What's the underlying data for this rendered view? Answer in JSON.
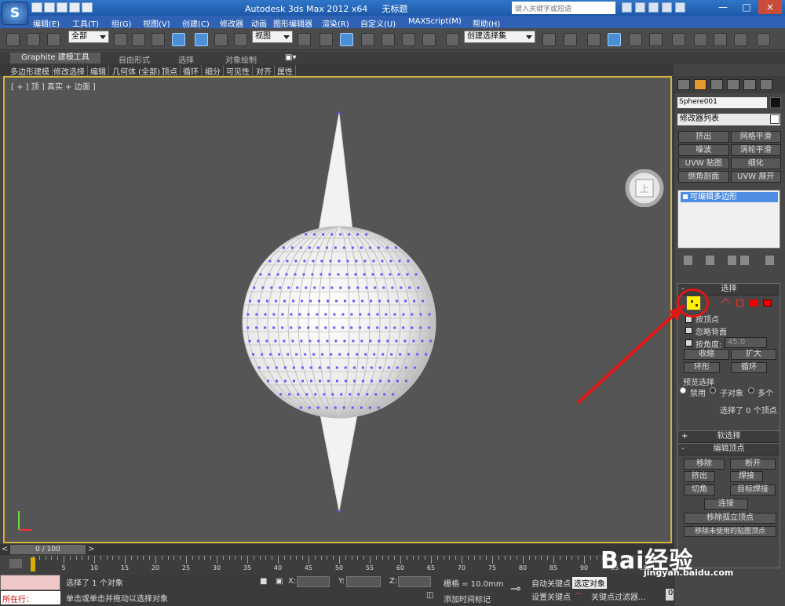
{
  "title": {
    "app": "Autodesk 3ds Max  2012 x64",
    "file": "无标题",
    "search": "键入关键字或短语"
  },
  "menu": [
    "编辑(E)",
    "工具(T)",
    "组(G)",
    "视图(V)",
    "创建(C)",
    "修改器",
    "动画",
    "图形编辑器",
    "渲染(R)",
    "自定义(U)",
    "MAXScript(M)",
    "帮助(H)"
  ],
  "toolbar": {
    "filter": "全部",
    "view": "视图",
    "selection_set": "创建选择集"
  },
  "ribbon": {
    "tabs": [
      "Graphite 建模工具",
      "自由形式",
      "选择",
      "对象绘制"
    ],
    "items": [
      "多边形建模",
      "修改选择",
      "编辑",
      "几何体 (全部)",
      "顶点",
      "循环",
      "细分",
      "可见性",
      "对齐",
      "属性"
    ]
  },
  "viewport": {
    "label": "[ + ] 顶 ] 真实 + 边面 ]"
  },
  "timeline": {
    "frame": "0 / 100",
    "ticks": [
      0,
      5,
      10,
      15,
      20,
      25,
      30,
      35,
      40,
      45,
      50,
      55,
      60,
      65,
      70,
      75,
      80,
      85,
      90,
      95,
      100
    ]
  },
  "status": {
    "cmd": "所在行：",
    "selected": "选择了 1 个对象",
    "help": "单击或单击并拖动以选择对象",
    "x_label": "X:",
    "y_label": "Y:",
    "z_label": "Z:",
    "grid": "栅格 = 10.0mm",
    "add_time": "添加时间标记",
    "auto_key": "自动关键点",
    "set_key": "设置关键点",
    "selected_object": "选定对象",
    "key_filter": "关键点过滤器...",
    "frame_value": "0"
  },
  "panel": {
    "object_name": "Sphere001",
    "modifier_list": "修改器列表",
    "buttons": [
      "挤出",
      "网格平滑",
      "噪波",
      "涡轮平滑",
      "UVW 贴图",
      "细化",
      "倒角剖面",
      "UVW 展开"
    ],
    "stack_item": "可编辑多边形",
    "selection_title": "选择",
    "soft_title": "软选择",
    "edit_title": "编辑顶点",
    "by_vertex": "按顶点",
    "ignore_back": "忽略背面",
    "by_angle": "按角度:",
    "angle": "45.0",
    "shrink": "收缩",
    "grow": "扩大",
    "ring": "环形",
    "loop": "循环",
    "preview": "预览选择",
    "disabled": "禁用",
    "sub_object": "子对象",
    "multi": "多个",
    "selected_count": "选择了 0 个顶点",
    "remove": "移除",
    "break": "断开",
    "extrude": "挤出",
    "weld": "焊接",
    "chamfer": "切角",
    "target_weld": "目标焊接",
    "connect": "连接",
    "remove_isolated": "移除孤立顶点",
    "remove_unused": "移除未使用的贴图顶点"
  },
  "watermark": {
    "text": "Bai经验",
    "sub": "jingyan.baidu.com"
  },
  "colors": {
    "viewport_border": "#d2b23a",
    "highlight": "#e31616"
  }
}
